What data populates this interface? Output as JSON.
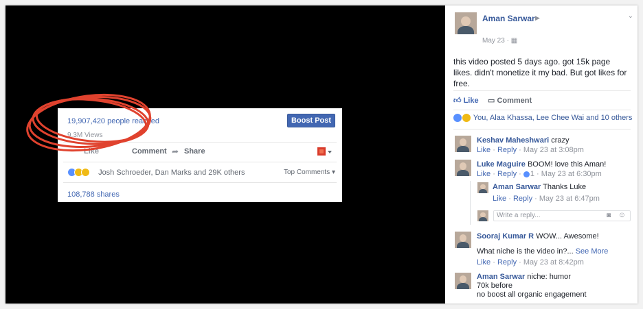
{
  "fb_card": {
    "reach": "19,907,420 people reached",
    "views": "9.3M Views",
    "boost_label": "Boost Post",
    "actions": {
      "like": "Like",
      "comment": "Comment",
      "share": "Share"
    },
    "reaction_names": "Josh Schroeder, Dan Marks and 29K others",
    "top_comments": "Top Comments ▾",
    "shares": "108,788 shares",
    "accent": "#4267b2"
  },
  "post": {
    "author": "Aman Sarwar",
    "date": "May 23 · ",
    "text": "this video posted 5 days ago. got 15k page likes. didn't monetize it my bad. But got likes for free.",
    "like_label": "Like",
    "comment_label": "Comment",
    "likes_line": "You, Alaa Khassa, Lee Chee Wai and 10 others"
  },
  "comments": [
    {
      "author": "Keshav Maheshwari",
      "text": "crazy",
      "like": "Like",
      "reply": "Reply",
      "time": "May 23 at 3:08pm"
    },
    {
      "author": "Luke Maguire",
      "text": "BOOM! love this Aman!",
      "like": "Like",
      "reply": "Reply",
      "count": "1",
      "time": "May 23 at 6:30pm"
    },
    {
      "author": "Aman Sarwar",
      "text": "Thanks Luke",
      "like": "Like",
      "reply": "Reply",
      "time": "May 23 at 6:47pm"
    },
    {
      "author": "Sooraj Kumar R",
      "text": "WOW... Awesome!",
      "text2": "What niche is the video in?...",
      "see_more": "See More",
      "like": "Like",
      "reply": "Reply",
      "time": "May 23 at 8:42pm"
    },
    {
      "author": "Aman Sarwar",
      "text": "niche: humor",
      "text2": "70k before",
      "text3": "no boost all organic engagement"
    }
  ],
  "reply_box": {
    "placeholder": "Write a reply..."
  }
}
